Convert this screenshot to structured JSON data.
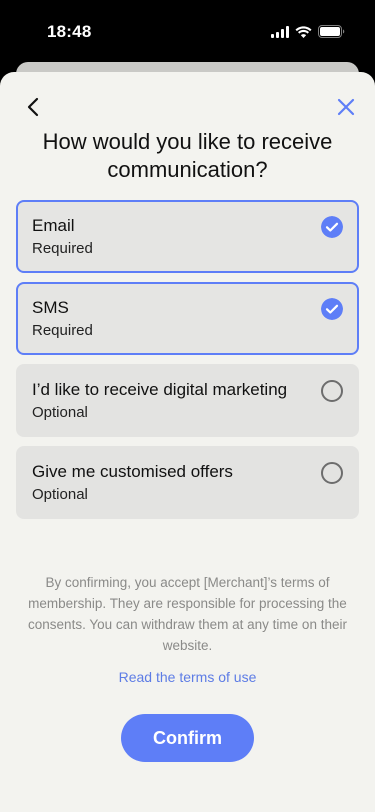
{
  "status_bar": {
    "time": "18:48"
  },
  "header": {
    "back_icon": "chevron-left-icon",
    "close_icon": "close-icon",
    "title": "How would you like to receive communication?"
  },
  "options": [
    {
      "label": "Email",
      "sub": "Required",
      "selected": true
    },
    {
      "label": "SMS",
      "sub": "Required",
      "selected": true
    },
    {
      "label": "I’d like to receive digital marketing",
      "sub": "Optional",
      "selected": false
    },
    {
      "label": "Give me customised offers",
      "sub": "Optional",
      "selected": false
    }
  ],
  "consent_text": "By confirming, you accept [Merchant]’s terms of membership. They are responsible for processing the consents. You can withdraw them at any time on their website.",
  "terms_link": "Read the terms of use",
  "confirm_label": "Confirm",
  "colors": {
    "accent": "#5e7ef7",
    "link": "#5d7ce5",
    "sheet_bg": "#f3f3ef",
    "option_bg": "#e3e3e1"
  }
}
